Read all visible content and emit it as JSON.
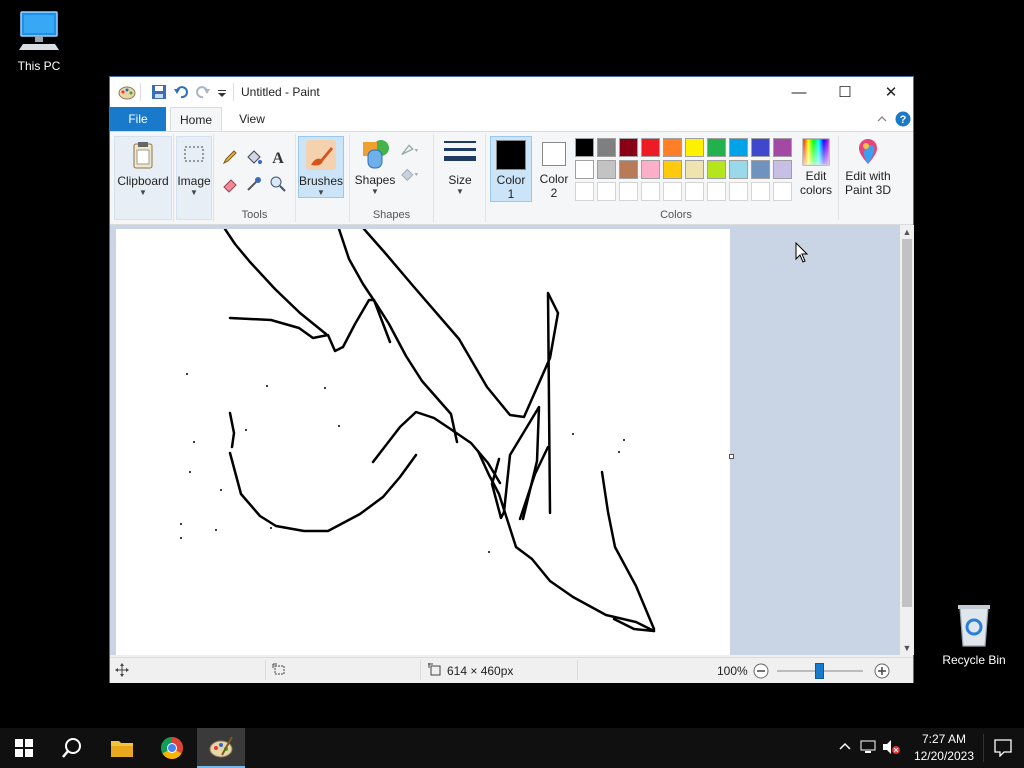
{
  "desktop": {
    "icons": [
      {
        "label": "This PC"
      },
      {
        "label": "Recycle Bin"
      }
    ]
  },
  "window": {
    "title": "Untitled - Paint",
    "controls": {
      "minimize": "—",
      "maximize": "☐",
      "close": "✕"
    }
  },
  "ribbon": {
    "tabs": {
      "file": "File",
      "home": "Home",
      "view": "View"
    },
    "groups": {
      "clipboard": {
        "label": "Clipboard"
      },
      "image": {
        "label": "Image"
      },
      "tools": {
        "label": "Tools"
      },
      "brushes": {
        "label": "Brushes"
      },
      "shapes": {
        "button": "Shapes",
        "label": "Shapes"
      },
      "size": {
        "label": "Size"
      },
      "color1": {
        "line1": "Color",
        "line2": "1"
      },
      "color2": {
        "line1": "Color",
        "line2": "2"
      },
      "colors": {
        "label": "Colors"
      },
      "edit_colors": {
        "line1": "Edit",
        "line2": "colors"
      },
      "edit_paint3d": {
        "line1": "Edit with",
        "line2": "Paint 3D"
      }
    },
    "palette": {
      "row1": [
        "#000000",
        "#7f7f7f",
        "#880015",
        "#ed1c24",
        "#ff7f27",
        "#fff200",
        "#22b14c",
        "#00a2e8",
        "#3f48cc",
        "#a349a4"
      ],
      "row2": [
        "#ffffff",
        "#c3c3c3",
        "#b97a57",
        "#ffaec9",
        "#ffc90e",
        "#efe4b0",
        "#b5e61d",
        "#99d9ea",
        "#7092be",
        "#c8bfe7"
      ],
      "color1": "#000000",
      "color2": "#ffffff"
    }
  },
  "statusbar": {
    "dimensions": "614 × 460px",
    "zoom": "100%",
    "zoom_level": 0.5
  },
  "taskbar": {
    "clock_time": "7:27 AM",
    "clock_date": "12/20/2023"
  }
}
